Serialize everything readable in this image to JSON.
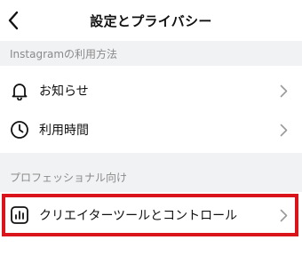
{
  "header": {
    "title": "設定とプライバシー"
  },
  "sections": [
    {
      "title": "Instagramの利用方法",
      "items": [
        {
          "label": "お知らせ",
          "icon": "bell-icon"
        },
        {
          "label": "利用時間",
          "icon": "clock-icon"
        }
      ]
    },
    {
      "title": "プロフェッショナル向け",
      "items": [
        {
          "label": "クリエイターツールとコントロール",
          "icon": "bar-chart-icon"
        }
      ]
    }
  ],
  "colors": {
    "highlight": "#d9141b",
    "section_background": "#f1f2f4",
    "section_text": "#8a8a8a",
    "chevron": "#9a9a9a"
  }
}
